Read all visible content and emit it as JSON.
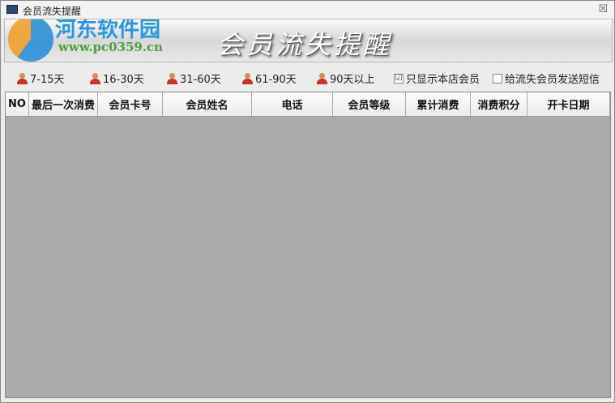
{
  "window": {
    "title": "会员流失提醒",
    "close": "☒"
  },
  "banner": {
    "title": "会员流失提醒",
    "watermark_name": "河东软件园",
    "watermark_url": "www.pc0359.cn"
  },
  "filters": [
    {
      "label": "7-15天"
    },
    {
      "label": "16-30天"
    },
    {
      "label": "31-60天"
    },
    {
      "label": "61-90天"
    },
    {
      "label": "90天以上"
    }
  ],
  "options": {
    "only_store": {
      "label": "只显示本店会员",
      "checked": true,
      "mark": "☑"
    },
    "send_sms": {
      "label": "给流失会员发送短信",
      "checked": false
    }
  },
  "table": {
    "columns": [
      "NO",
      "最后一次消费",
      "会员卡号",
      "会员姓名",
      "电话",
      "会员等级",
      "累计消费",
      "消费积分",
      "开卡日期"
    ],
    "rows": []
  }
}
